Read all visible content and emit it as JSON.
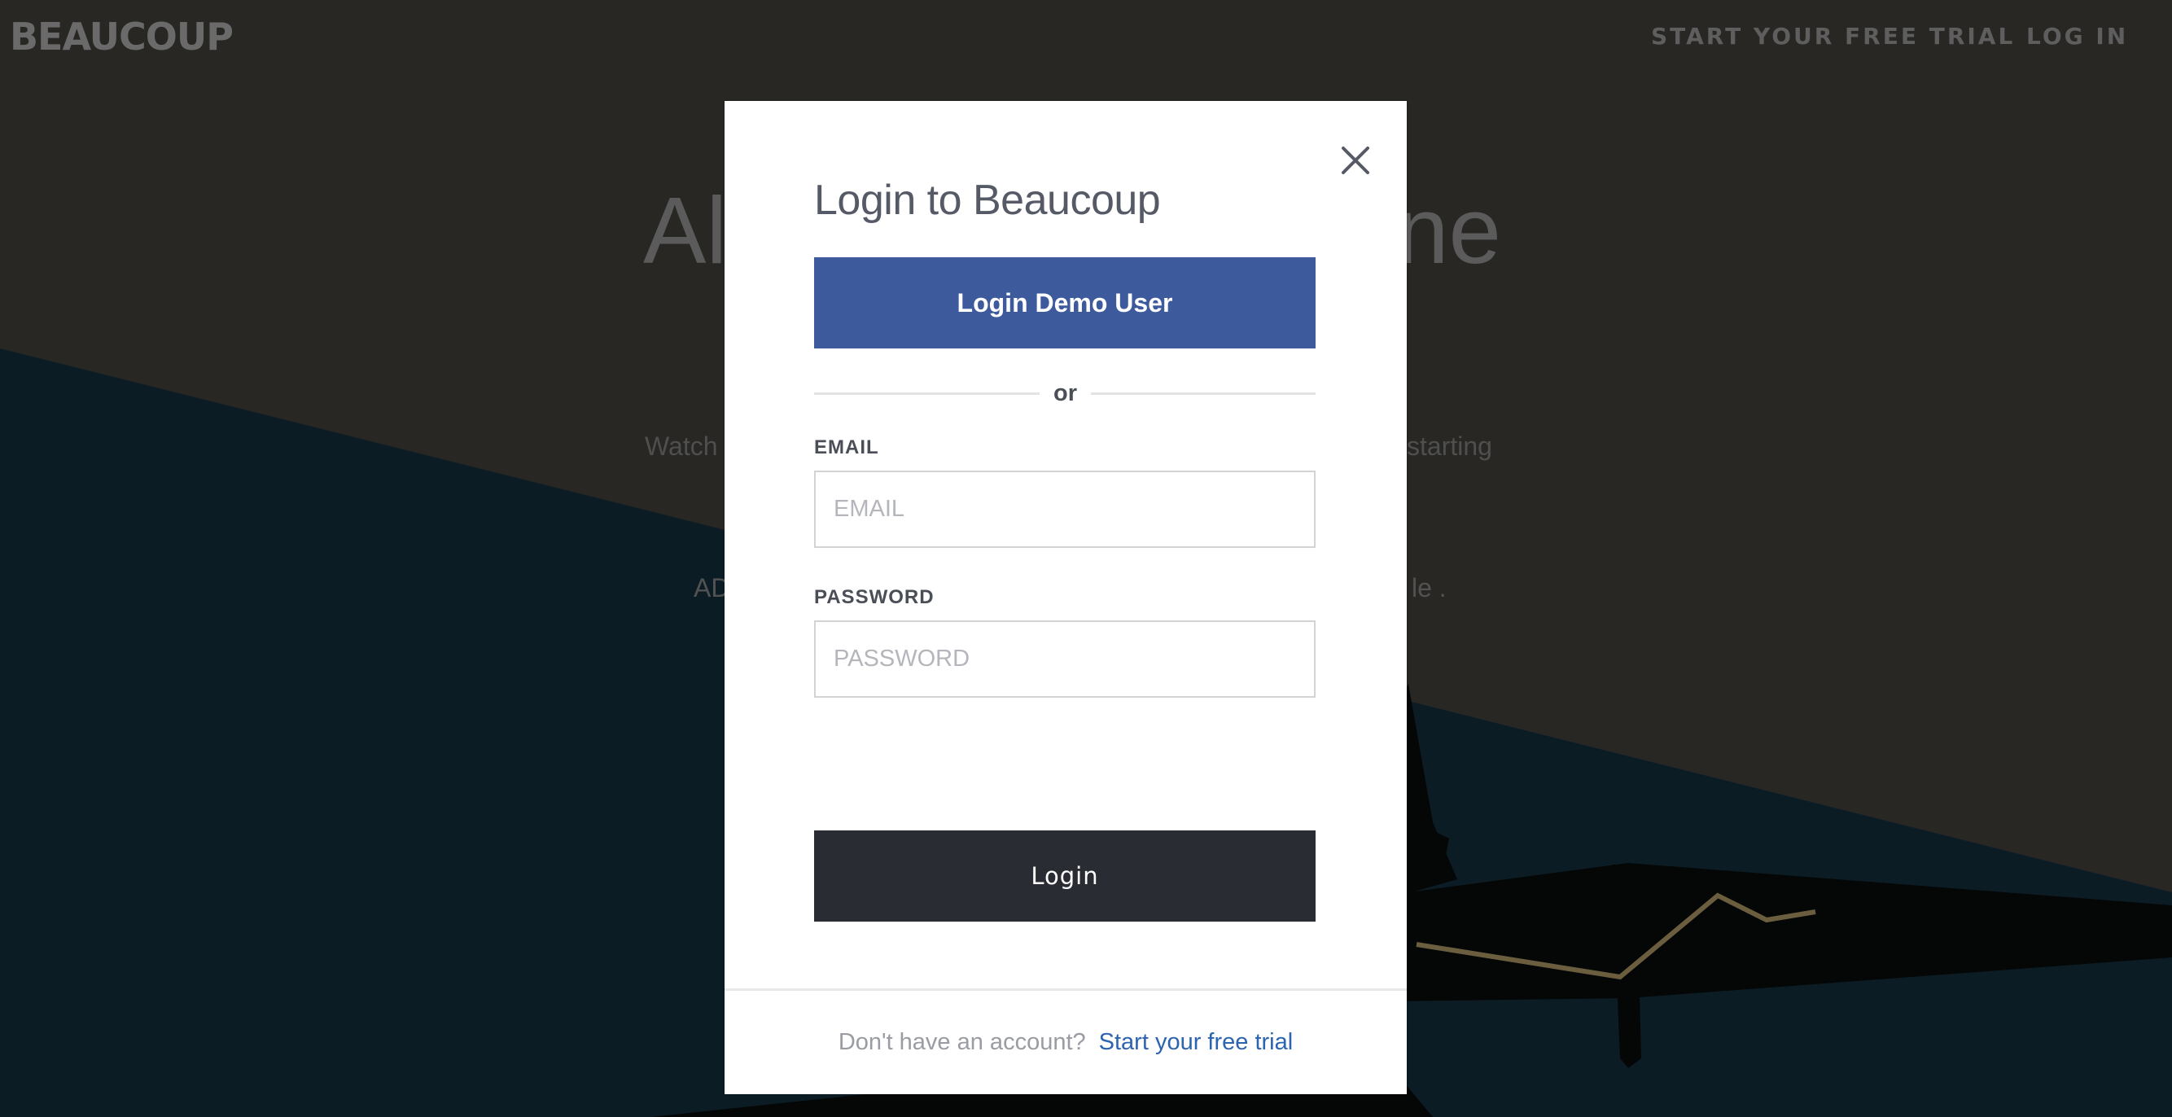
{
  "nav": {
    "logo": "BEAUCOUP",
    "links": [
      "START YOUR FREE TRIAL",
      "LOG IN"
    ]
  },
  "hero": {
    "title_left": "Al",
    "title_right": "ne",
    "subtitle_left": "Watch",
    "subtitle_right": "starting",
    "ad_left": "AD",
    "ad_right": "le ."
  },
  "modal": {
    "title": "Login to Beaucoup",
    "demo_button": "Login Demo User",
    "divider": "or",
    "email": {
      "label": "EMAIL",
      "placeholder": "EMAIL",
      "value": ""
    },
    "password": {
      "label": "PASSWORD",
      "placeholder": "PASSWORD",
      "value": ""
    },
    "login_button": "Login",
    "footer": {
      "text": "Don't have an account?",
      "link": "Start your free trial"
    }
  },
  "colors": {
    "background_top": "#282724",
    "background_bottom": "#0c1c24",
    "demo_button": "#3d5a9c",
    "login_button": "#2a2c33",
    "link": "#2c64b0"
  },
  "icons": {
    "close": "close-icon"
  }
}
